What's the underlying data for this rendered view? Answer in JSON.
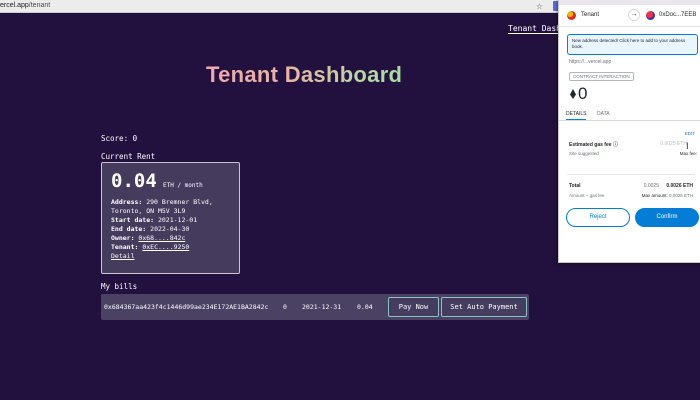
{
  "browser": {
    "url_host": "ercel.app",
    "url_path": "/tenant"
  },
  "nav": {
    "tenant_link": "Tenant Dashboard"
  },
  "page": {
    "title": "Tenant Dashboard",
    "score_label": "Score: 0",
    "current_rent_heading": "Current Rent",
    "my_bills_heading": "My bills"
  },
  "rent": {
    "amount": "0.04",
    "unit": "ETH / month",
    "address_label": "Address:",
    "address_line1": "290 Bremner Blvd,",
    "address_line2": "Toronto, ON M5V 3L9",
    "start_label": "Start date:",
    "start_date": "2021-12-01",
    "end_label": "End date:",
    "end_date": "2022-04-30",
    "owner_label": "Owner:",
    "owner": "0x68....842c",
    "tenant_label": "Tenant:",
    "tenant": "0xEC....9250",
    "detail_link": "Detail"
  },
  "bills": [
    {
      "address": "0x684367aa423f4c1446d99ae234E172AE1BA2842c",
      "status": "0",
      "due_date": "2021-12-31",
      "amount": "0.04",
      "pay_label": "Pay Now",
      "auto_label": "Set Auto Payment"
    }
  ],
  "wallet": {
    "account_from": "Tenant",
    "account_to": "0xDoc...7EEB",
    "notice": "New address detected! Click here to add to your address book.",
    "origin": "https://...vercel.app",
    "tag": "CONTRACT INTERACTION",
    "amount": "0",
    "tabs": [
      "DETAILS",
      "DATA"
    ],
    "edit_label": "EDIT",
    "gas_label": "Estimated gas fee",
    "gas_value": "0.0025 ETH",
    "site_suggested": "Site suggested",
    "max_fee_label": "Max fee:",
    "total_label": "Total",
    "total_small": "0.0025",
    "total_value": "0.0026 ETH",
    "amount_gas_label": "Amount + gas fee",
    "max_amount_label": "Max amount:",
    "max_amount_value": "0.0025 ETH",
    "reject_label": "Reject",
    "confirm_label": "Confirm"
  },
  "colors": {
    "page_bg": "#22113e",
    "card_bg": "#453c5d",
    "button_border": "#8bc1bf",
    "wallet_accent": "#037dd6"
  },
  "icons": [
    "star-icon",
    "metamask-extension-icon",
    "fox-extension-icon",
    "arrow-right-icon",
    "ethereum-icon",
    "info-icon",
    "text-cursor-icon"
  ]
}
